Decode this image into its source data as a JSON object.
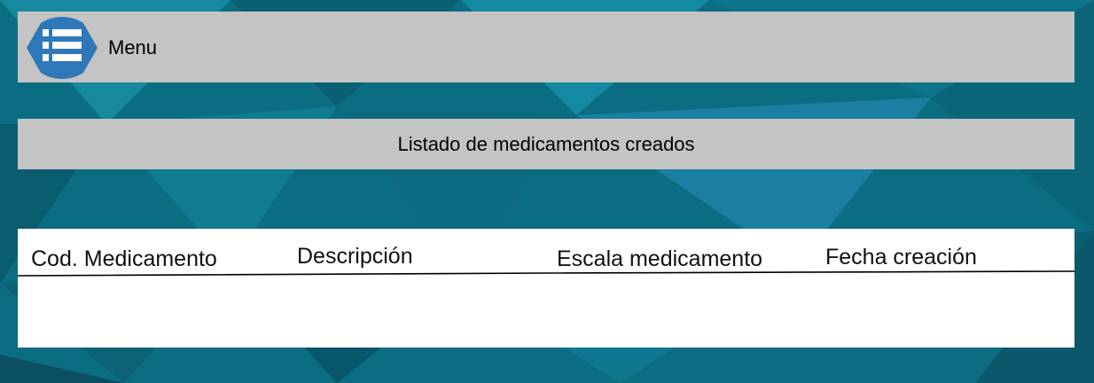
{
  "header": {
    "menu_icon": "menu-list-icon",
    "menu_label": "Menu"
  },
  "page": {
    "title": "Listado de medicamentos creados"
  },
  "table": {
    "columns": [
      "Cod. Medicamento",
      "Descripción",
      "Escala medicamento",
      "Fecha creación"
    ],
    "rows": []
  },
  "colors": {
    "background": "#0b6d82",
    "bar": "#c4c4c4",
    "menu_button": "#2e78b9",
    "table": "#ffffff"
  }
}
